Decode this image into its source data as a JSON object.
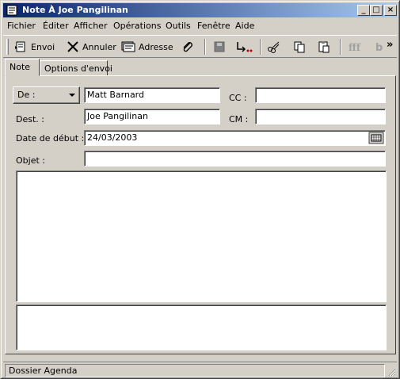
{
  "window": {
    "title": "Note À  Joe Pangilinan",
    "minimize": "_",
    "maximize": "□",
    "close": "×"
  },
  "menu": {
    "items": [
      "Fichier",
      "Éditer",
      "Afficher",
      "Opérations",
      "Outils",
      "Fenêtre",
      "Aide"
    ]
  },
  "toolbar": {
    "send": "Envoi",
    "cancel": "Annuler",
    "address": "Adresse",
    "overflow": "»"
  },
  "tabs": {
    "note": "Note",
    "send_options": "Options d'envoi"
  },
  "form": {
    "from_label": "De :",
    "from_value": "Matt Barnard",
    "to_label": "Dest. :",
    "to_value": "Joe Pangilinan",
    "cc_label": "CC :",
    "cc_value": "",
    "bc_label": "CM :",
    "bc_value": "",
    "start_date_label": "Date de début :",
    "start_date_value": "24/03/2003",
    "subject_label": "Objet :",
    "subject_value": "",
    "body_value": "",
    "body2_value": ""
  },
  "status": {
    "text": "Dossier Agenda"
  },
  "colors": {
    "title_start": "#0a246a",
    "title_end": "#a6caf0",
    "face": "#d4d0c8"
  }
}
